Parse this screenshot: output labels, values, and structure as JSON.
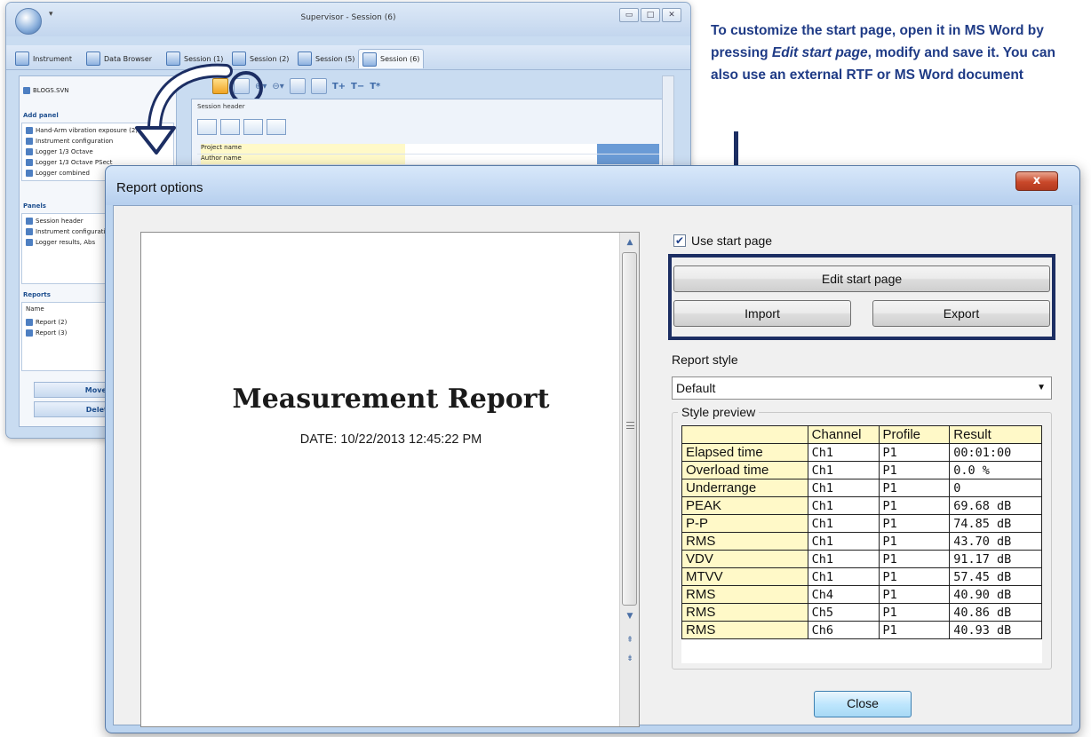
{
  "background_window": {
    "title": "Supervisor - Session (6)",
    "tabs": [
      "Instrument",
      "Data Browser",
      "Session (1)",
      "Session (2)",
      "Session (5)",
      "Session (6)"
    ],
    "left_panel": {
      "top_item": "BLOGS.SVN",
      "add_panel_title": "Add panel",
      "add_panel_items": [
        "Hand-Arm vibration exposure (2)",
        "Instrument configuration",
        "Logger 1/3 Octave",
        "Logger 1/3 Octave PSect",
        "Logger combined"
      ],
      "panels_title": "Panels",
      "panels_items": [
        "Session header",
        "Instrument configuration",
        "Logger results, Abs"
      ],
      "reports_title": "Reports",
      "reports_col": "Name",
      "reports_items": [
        "Report (2)",
        "Report (3)"
      ],
      "btn_move": "Move to a",
      "btn_delete": "Delete se"
    },
    "session_header": "Session header",
    "grid_rows": [
      "Project name",
      "Author name"
    ]
  },
  "callout": {
    "line1": "To customize the start page, open it in MS Word by pressing ",
    "emph": "Edit start page",
    "line2": ", modify and save it. You can also use an external RTF or MS Word document"
  },
  "dialog": {
    "title": "Report options",
    "close_x": "x",
    "preview": {
      "title": "Measurement Report",
      "date": "DATE: 10/22/2013 12:45:22 PM"
    },
    "use_start_page": "Use start page",
    "use_start_page_checked": true,
    "edit_start_page": "Edit start page",
    "import": "Import",
    "export": "Export",
    "report_style_label": "Report style",
    "report_style_value": "Default",
    "style_preview_label": "Style preview",
    "table": {
      "headers": [
        "",
        "Channel",
        "Profile",
        "Result"
      ],
      "rows": [
        [
          "Elapsed time",
          "Ch1",
          "P1",
          "00:01:00"
        ],
        [
          "Overload time",
          "Ch1",
          "P1",
          "0.0 %"
        ],
        [
          "Underrange",
          "Ch1",
          "P1",
          "0"
        ],
        [
          "PEAK",
          "Ch1",
          "P1",
          "69.68 dB"
        ],
        [
          "P-P",
          "Ch1",
          "P1",
          "74.85 dB"
        ],
        [
          "RMS",
          "Ch1",
          "P1",
          "43.70 dB"
        ],
        [
          "VDV",
          "Ch1",
          "P1",
          "91.17 dB"
        ],
        [
          "MTVV",
          "Ch1",
          "P1",
          "57.45 dB"
        ],
        [
          "RMS",
          "Ch4",
          "P1",
          "40.90 dB"
        ],
        [
          "RMS",
          "Ch5",
          "P1",
          "40.86 dB"
        ],
        [
          "RMS",
          "Ch6",
          "P1",
          "40.93 dB"
        ]
      ]
    },
    "close_button": "Close"
  },
  "colors": {
    "accent_navy": "#1c2e63",
    "callout_text": "#1f3b86",
    "table_label_bg": "#fff9c8",
    "close_x_red": "#c9482a"
  }
}
